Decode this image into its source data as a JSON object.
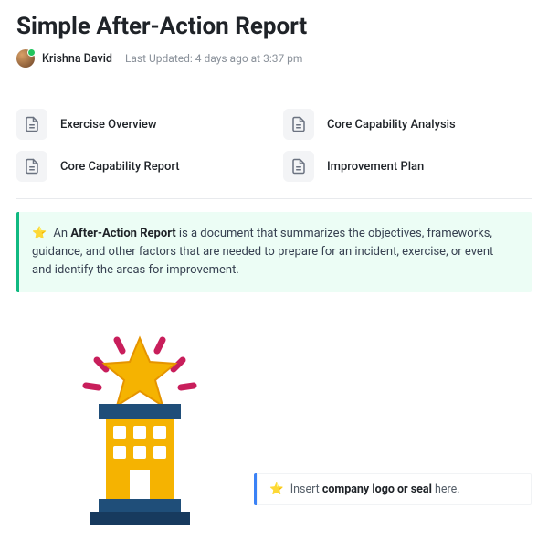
{
  "title": "Simple After-Action Report",
  "author": "Krishna David",
  "last_updated": "Last Updated: 4 days ago at 3:37 pm",
  "nav": {
    "items": [
      {
        "label": "Exercise Overview"
      },
      {
        "label": "Core Capability Analysis"
      },
      {
        "label": "Core Capability Report"
      },
      {
        "label": "Improvement Plan"
      }
    ]
  },
  "callout": {
    "prefix": "An ",
    "bold": "After-Action Report",
    "rest": " is a document that summarizes the objectives, frameworks, guidance, and other factors that are needed to prepare for an incident, exercise, or event and identify the areas for improvement."
  },
  "logo_hint": {
    "prefix": "Insert ",
    "bold": "company logo or seal",
    "rest": " here."
  },
  "icons": {
    "star": "⭐",
    "doc_stroke": "#6b7280"
  },
  "colors": {
    "callout_bg": "#ecfdf5",
    "callout_border": "#10b981",
    "logo_border": "#3b82f6"
  }
}
